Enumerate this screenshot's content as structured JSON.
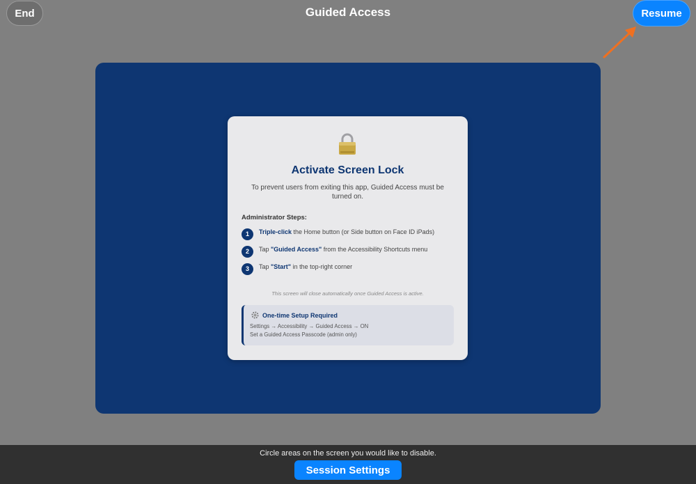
{
  "top_bar": {
    "end_label": "End",
    "title": "Guided Access",
    "resume_label": "Resume"
  },
  "card": {
    "icon": "lock-icon",
    "title": "Activate Screen Lock",
    "description": "To prevent users from exiting this app, Guided Access must be turned on.",
    "steps_heading": "Administrator Steps:",
    "steps": [
      {
        "num": "1",
        "bold": "Triple-click",
        "rest": " the Home button (or Side button on Face ID iPads)"
      },
      {
        "num": "2",
        "pre": "Tap ",
        "bold": "\"Guided Access\"",
        "rest": " from the Accessibility Shortcuts menu"
      },
      {
        "num": "3",
        "pre": "Tap ",
        "bold": "\"Start\"",
        "rest": " in the top-right corner"
      }
    ],
    "auto_close_note": "This screen will close automatically once Guided Access is active.",
    "setup": {
      "icon": "gear-icon",
      "title": "One-time Setup Required",
      "line1": "Settings → Accessibility → Guided Access → ON",
      "line2": "Set a Guided Access Passcode (admin only)"
    }
  },
  "bottom_bar": {
    "hint": "Circle areas on the screen you would like to disable.",
    "session_settings_label": "Session Settings"
  },
  "colors": {
    "accent": "#0a84ff",
    "app_background": "#0e3672",
    "overlay_gray": "#808080",
    "annotation_arrow": "#f07020"
  }
}
